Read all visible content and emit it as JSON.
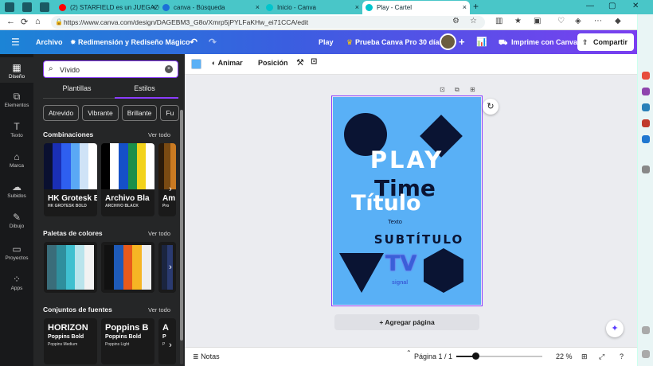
{
  "browser": {
    "tabs": [
      {
        "title": "(2) STARFIELD es un JUEGAZO",
        "color": "#ff0000"
      },
      {
        "title": "canva - Búsqueda",
        "color": "#1b6fd8"
      },
      {
        "title": "Inicio - Canva",
        "color": "#00c4cc"
      },
      {
        "title": "Play - Cartel",
        "color": "#00c4cc"
      }
    ],
    "url": "https://www.canva.com/design/DAGEBM3_G8o/Xmrp5jPYLFaKHw_ei71CCA/edit"
  },
  "header": {
    "archivo": "Archivo",
    "project_title": "Redimensión y Rediseño Mágico",
    "play": "Play",
    "pro_trial": "Prueba Canva Pro 30 días",
    "print": "Imprime con Canva",
    "share": "Compartir"
  },
  "rail": [
    {
      "label": "Diseño",
      "glyph": "▦",
      "icon": "layout-icon"
    },
    {
      "label": "Elementos",
      "glyph": "⧉",
      "icon": "shapes-icon"
    },
    {
      "label": "Texto",
      "glyph": "T",
      "icon": "text-icon"
    },
    {
      "label": "Marca",
      "glyph": "⌂",
      "icon": "brand-icon"
    },
    {
      "label": "Subidos",
      "glyph": "☁",
      "icon": "cloud-upload-icon"
    },
    {
      "label": "Dibujo",
      "glyph": "✎",
      "icon": "pen-icon"
    },
    {
      "label": "Proyectos",
      "glyph": "▭",
      "icon": "folder-icon"
    },
    {
      "label": "Apps",
      "glyph": "⁘",
      "icon": "apps-icon"
    }
  ],
  "panel": {
    "search_value": "Vívido",
    "tabs": [
      "Plantillas",
      "Estilos"
    ],
    "chips": [
      "Atrevido",
      "Vibrante",
      "Brillante",
      "Fu"
    ],
    "combinaciones": {
      "title": "Combinaciones",
      "see_all": "Ver todo",
      "cards": [
        {
          "font": "HK Grotesk B",
          "sub": "HK GROTESK BOLD",
          "colors": [
            "#0a1030",
            "#1a2fb5",
            "#2e5ff0",
            "#5aa8f5",
            "#cfe3f7",
            "#ffffff"
          ]
        },
        {
          "font": "Archivo Bla",
          "sub": "ARCHIVO BLACK",
          "colors": [
            "#000000",
            "#ffffff",
            "#1550c8",
            "#1b8f4a",
            "#f2d21a",
            "#ffffff"
          ]
        },
        {
          "font": "Am",
          "sub": "Pro",
          "colors": [
            "#2a1a0a",
            "#7a4a12",
            "#c97a22"
          ]
        }
      ]
    },
    "paletas": {
      "title": "Paletas de colores",
      "see_all": "Ver todo",
      "cards": [
        {
          "colors": [
            "#3a6d7a",
            "#2f8f9d",
            "#3fc0d0",
            "#b9e4ec",
            "#f2f2f2"
          ]
        },
        {
          "colors": [
            "#111111",
            "#1e5ab8",
            "#e85a1b",
            "#f6b524",
            "#eeeeee"
          ]
        },
        {
          "colors": [
            "#1b2540",
            "#2a3a70"
          ]
        }
      ]
    },
    "conjuntos": {
      "title": "Conjuntos de fuentes",
      "see_all": "Ver todo",
      "cards": [
        {
          "a": "HORIZON",
          "b": "Poppins Bold",
          "c": "Poppins Medium"
        },
        {
          "a": "Poppins B",
          "b": "Poppins Bold",
          "c": "Poppins Light"
        },
        {
          "a": "A",
          "b": "P",
          "c": "P"
        }
      ]
    }
  },
  "toolbar": {
    "color": "#59b0f6",
    "animar": "Animar",
    "posicion": "Posición"
  },
  "design": {
    "background": "#59b0f6",
    "dark": "#0a1433",
    "play": "PLAY",
    "time": "Time",
    "titulo": "Título",
    "texto": "Texto",
    "subtitulo": "SUBTÍTULO",
    "tv": "TV",
    "signal": "signal"
  },
  "workspace": {
    "add_page": "+ Agregar página"
  },
  "bottom": {
    "notes": "Notas",
    "page_indicator": "Página 1 / 1",
    "zoom": "22 %",
    "zoom_level": 0.22
  }
}
